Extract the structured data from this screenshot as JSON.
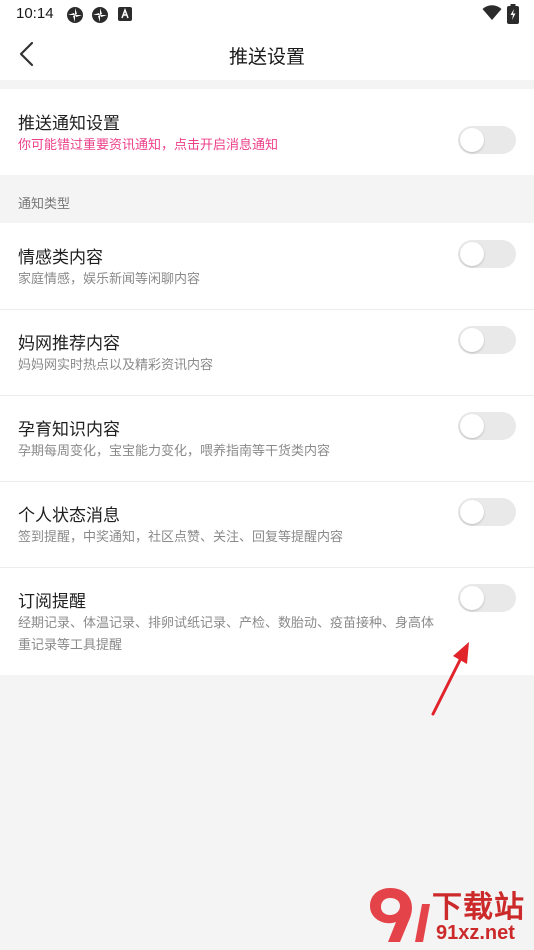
{
  "status_bar": {
    "time": "10:14",
    "icons": [
      "pinwheel-icon",
      "pinwheel-icon",
      "app-notification-icon",
      "wifi-icon",
      "battery-charging-icon"
    ]
  },
  "header": {
    "title": "推送设置",
    "back_icon": "chevron-left-icon"
  },
  "push_notification": {
    "title": "推送通知设置",
    "description": "你可能错过重要资讯通知，点击开启消息通知",
    "enabled": false,
    "accent_color": "#ee3f8a"
  },
  "notification_types": {
    "section_label": "通知类型",
    "items": [
      {
        "title": "情感类内容",
        "description": "家庭情感，娱乐新闻等闲聊内容",
        "enabled": false
      },
      {
        "title": "妈网推荐内容",
        "description": "妈妈网实时热点以及精彩资讯内容",
        "enabled": false
      },
      {
        "title": "孕育知识内容",
        "description": "孕期每周变化，宝宝能力变化，喂养指南等干货类内容",
        "enabled": false
      },
      {
        "title": "个人状态消息",
        "description": "签到提醒，中奖通知，社区点赞、关注、回复等提醒内容",
        "enabled": false
      },
      {
        "title": "订阅提醒",
        "description": "经期记录、体温记录、排卵试纸记录、产检、数胎动、疫苗接种、身高体重记录等工具提醒",
        "enabled": false
      }
    ]
  },
  "watermark": {
    "logo_text": "下载站",
    "url_text": "91xz.net"
  },
  "colors": {
    "annotation_arrow": "#e0242a",
    "toggle_off": "#e9e9e9",
    "page_background": "#f5f4f5"
  }
}
